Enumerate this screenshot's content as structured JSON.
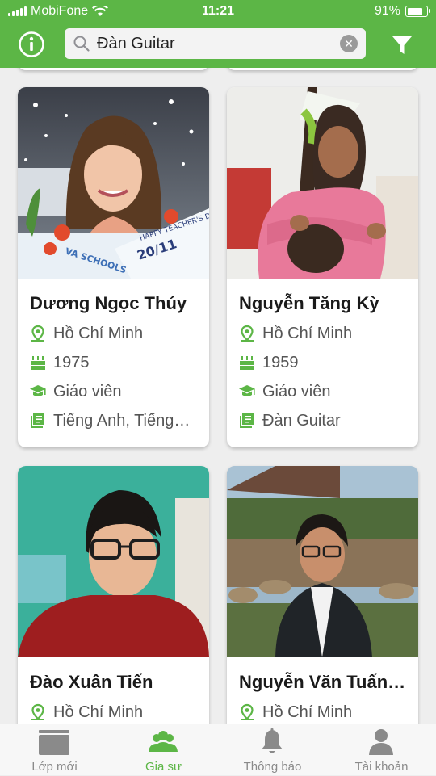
{
  "status_bar": {
    "carrier": "MobiFone",
    "time": "11:21",
    "battery": "91%",
    "battery_level": 0.91
  },
  "search": {
    "value": "Đàn Guitar",
    "placeholder": ""
  },
  "colors": {
    "accent": "#5cb646",
    "tab_inactive": "#8a8a8a"
  },
  "tutors": [
    {
      "name": "Dương Ngọc Thúy",
      "city": "Hồ Chí Minh",
      "year": "1975",
      "job": "Giáo viên",
      "subjects": "Tiếng Anh, Tiếng…"
    },
    {
      "name": "Nguyễn Tăng Kỳ",
      "city": "Hồ Chí Minh",
      "year": "1959",
      "job": "Giáo viên",
      "subjects": "Đàn Guitar"
    },
    {
      "name": "Đào Xuân Tiến",
      "city": "Hồ Chí Minh"
    },
    {
      "name": "Nguyễn Văn Tuấn…",
      "city": "Hồ Chí Minh"
    }
  ],
  "photo_texts": {
    "banner": "HAPPY TEACHER'S DAY",
    "date": "20/11",
    "school": "VA SCHOOLS"
  },
  "tabs": [
    {
      "label": "Lớp mới",
      "icon": "classroom-icon"
    },
    {
      "label": "Gia sư",
      "icon": "tutors-icon"
    },
    {
      "label": "Thông báo",
      "icon": "bell-icon"
    },
    {
      "label": "Tài khoản",
      "icon": "account-icon"
    }
  ]
}
